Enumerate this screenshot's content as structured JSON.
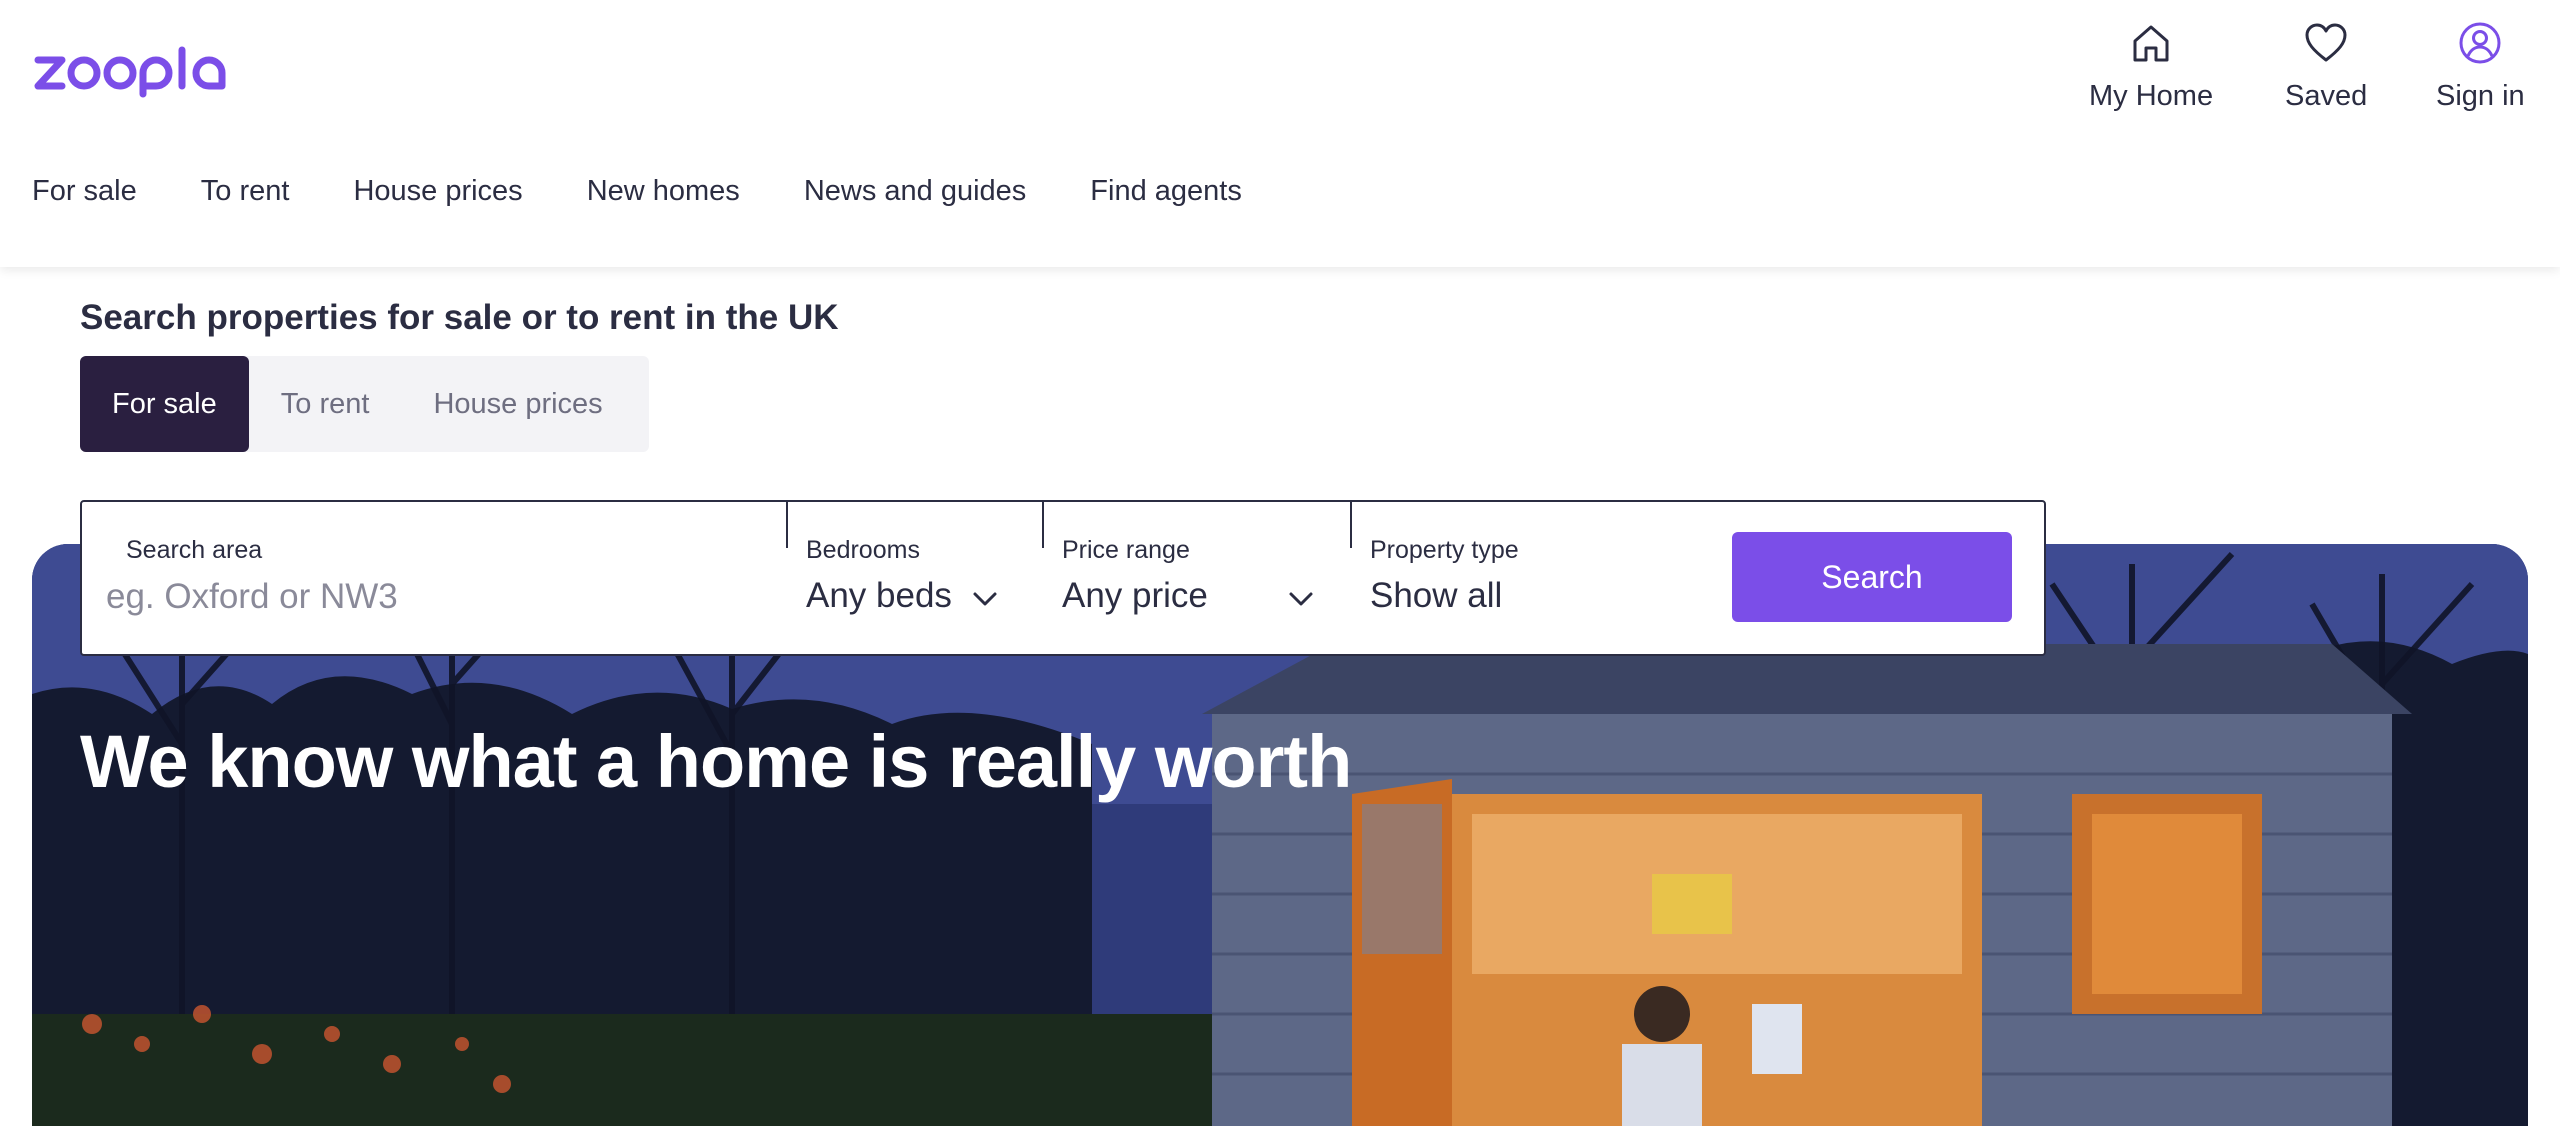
{
  "brand": {
    "logo_text": "zoopla",
    "accent_color": "#7b4ee8",
    "dark_color": "#2a1f40"
  },
  "utility_nav": [
    {
      "label": "My Home",
      "icon": "home-icon"
    },
    {
      "label": "Saved",
      "icon": "heart-icon"
    },
    {
      "label": "Sign in",
      "icon": "user-circle-icon"
    }
  ],
  "main_nav": [
    "For sale",
    "To rent",
    "House prices",
    "New homes",
    "News and guides",
    "Find agents"
  ],
  "search": {
    "heading": "Search properties for sale or to rent in the UK",
    "tabs": [
      {
        "label": "For sale",
        "active": true
      },
      {
        "label": "To rent",
        "active": false
      },
      {
        "label": "House prices",
        "active": false
      }
    ],
    "area": {
      "label": "Search area",
      "placeholder": "eg. Oxford or NW3",
      "value": ""
    },
    "bedrooms": {
      "label": "Bedrooms",
      "value": "Any beds"
    },
    "price": {
      "label": "Price range",
      "value": "Any price"
    },
    "property_type": {
      "label": "Property type",
      "value": "Show all"
    },
    "button_label": "Search"
  },
  "hero": {
    "headline": "We know what a home is really worth"
  }
}
